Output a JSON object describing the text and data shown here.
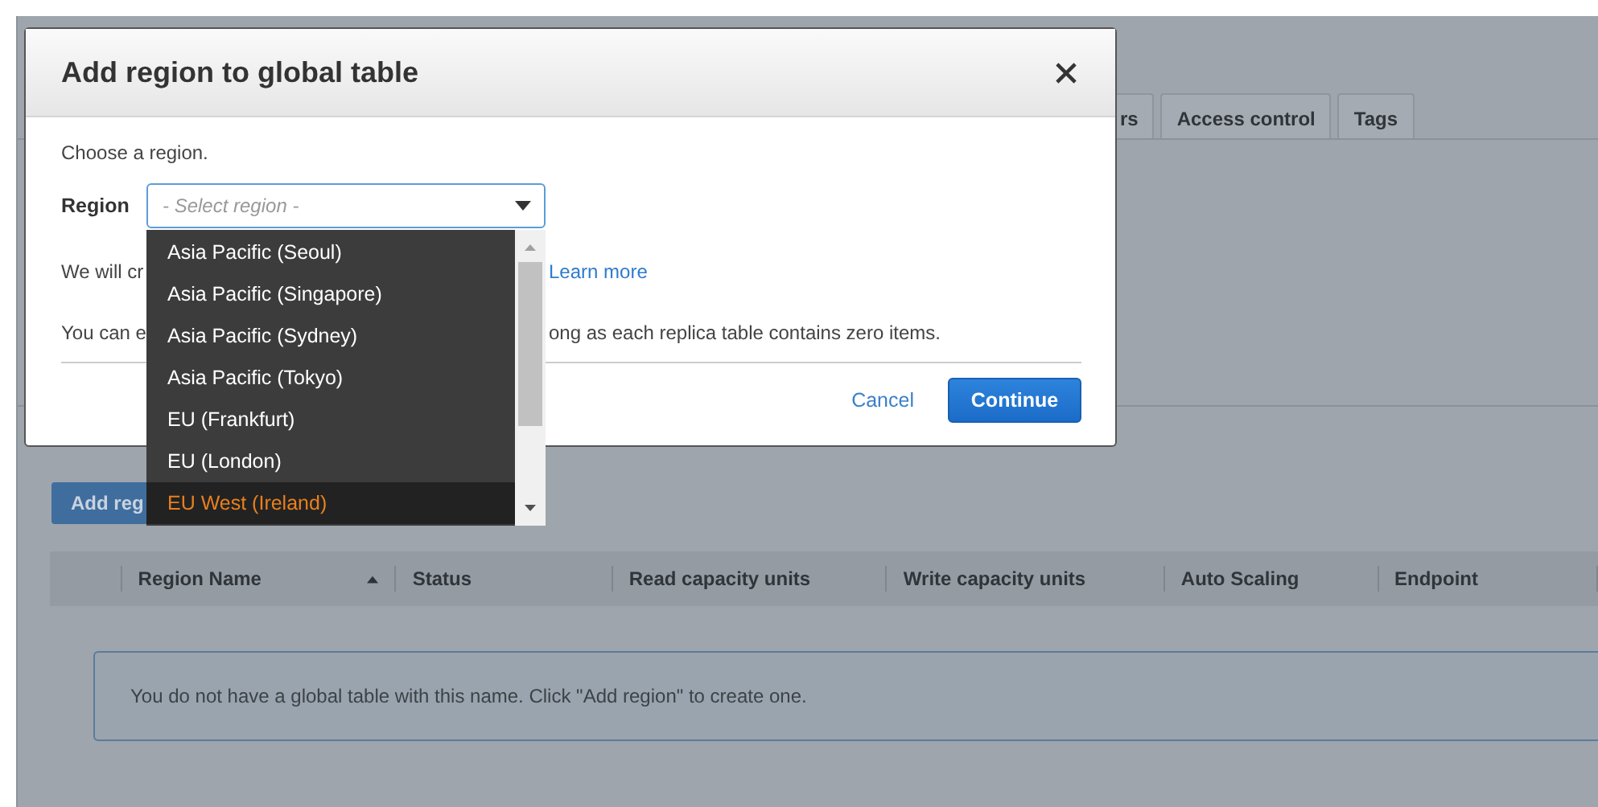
{
  "background": {
    "tabs": [
      {
        "label": "rs",
        "selected": false
      },
      {
        "label": "Access control",
        "selected": false
      },
      {
        "label": "Tags",
        "selected": false
      }
    ],
    "add_button": "Add reg",
    "table": {
      "columns": [
        {
          "label": "Region Name",
          "sorted": true
        },
        {
          "label": "Status",
          "sorted": false
        },
        {
          "label": "Read capacity units",
          "sorted": false
        },
        {
          "label": "Write capacity units",
          "sorted": false
        },
        {
          "label": "Auto Scaling",
          "sorted": false
        },
        {
          "label": "Endpoint",
          "sorted": false
        }
      ],
      "empty_message": "You do not have a global table with this name. Click \"Add region\" to create one."
    }
  },
  "dialog": {
    "title": "Add region to global table",
    "intro": "Choose a region.",
    "field_label": "Region",
    "select": {
      "placeholder": "- Select region -"
    },
    "options": [
      {
        "label": "Asia Pacific (Seoul)",
        "selected": false
      },
      {
        "label": "Asia Pacific (Singapore)",
        "selected": false
      },
      {
        "label": "Asia Pacific (Sydney)",
        "selected": false
      },
      {
        "label": "Asia Pacific (Tokyo)",
        "selected": false
      },
      {
        "label": "EU (Frankfurt)",
        "selected": false
      },
      {
        "label": "EU (London)",
        "selected": false
      },
      {
        "label": "EU West (Ireland)",
        "selected": true
      }
    ],
    "info_lines": [
      {
        "before": "We will cr",
        "after": "Learn more",
        "kind": "link"
      },
      {
        "before": "You can e",
        "after": "ong as each replica table contains zero items.",
        "kind": "text"
      }
    ],
    "buttons": {
      "cancel": "Cancel",
      "continue": "Continue"
    }
  }
}
